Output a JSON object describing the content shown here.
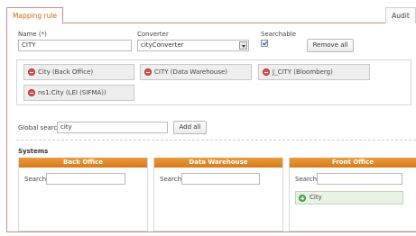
{
  "tabs": {
    "active": "Mapping rule",
    "right": "Audit"
  },
  "form": {
    "name_label": "Name (*)",
    "name_value": "CITY",
    "converter_label": "Converter",
    "converter_value": "cityConverter",
    "searchable_label": "Searchable",
    "searchable_checked": true,
    "remove_all_label": "Remove all"
  },
  "mapped_items": [
    "City (Back Office)",
    "CITY (Data Warehouse)",
    "J_CITY (Bloomberg)",
    "ns1:City (LEI (SIFMA))"
  ],
  "global_search": {
    "label": "Global search",
    "value": "city",
    "add_all_label": "Add all"
  },
  "systems": {
    "title": "Systems",
    "search_label": "Search",
    "columns": [
      {
        "name": "Back Office",
        "items": []
      },
      {
        "name": "Data Warehouse",
        "items": []
      },
      {
        "name": "Front Office",
        "items": [
          "City"
        ]
      }
    ]
  },
  "colors": {
    "accent": "#d87b1a",
    "tab_text": "#d06a10",
    "remove_icon": "#d9534f",
    "add_icon": "#5cb85c"
  }
}
